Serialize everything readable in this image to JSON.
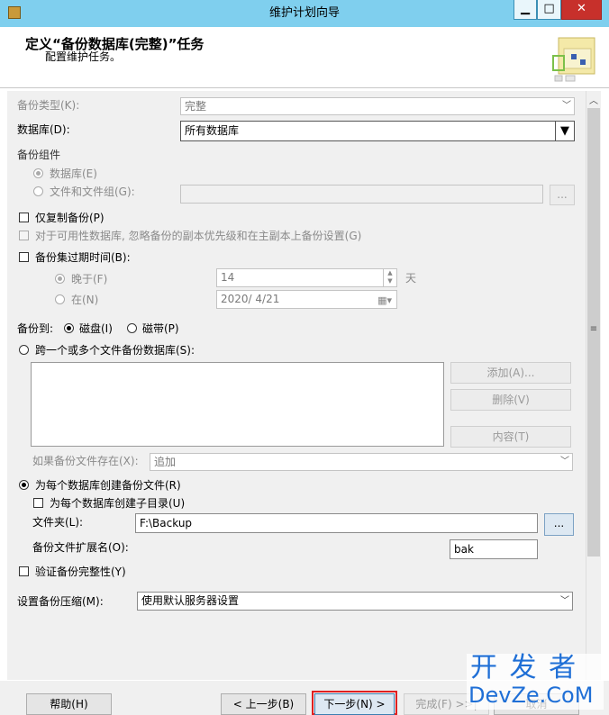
{
  "window": {
    "title": "维护计划向导",
    "minimize": "▁",
    "maximize": "□",
    "close": "✕"
  },
  "header": {
    "title": "定义“备份数据库(完整)”任务",
    "subtitle": "配置维护任务。"
  },
  "form": {
    "backup_type_label": "备份类型(K):",
    "backup_type_value": "完整",
    "database_label": "数据库(D):",
    "database_value": "所有数据库",
    "component_group_label": "备份组件",
    "component_database": "数据库(E)",
    "component_files": "文件和文件组(G):",
    "browse_label": "...",
    "copy_only_label": "仅复制备份(P)",
    "availability_label": "对于可用性数据库, 忽略备份的副本优先级和在主副本上备份设置(G)",
    "expire_label": "备份集过期时间(B):",
    "after_label": "晚于(F)",
    "after_value": "14",
    "days_unit": "天",
    "on_label": "在(N)",
    "on_value": "2020/ 4/21",
    "backup_to_label": "备份到:",
    "disk_label": "磁盘(I)",
    "tape_label": "磁带(P)",
    "span_label": "跨一个或多个文件备份数据库(S):",
    "add_button": "添加(A)...",
    "remove_button": "删除(V)",
    "contents_button": "内容(T)",
    "if_exists_label": "如果备份文件存在(X):",
    "if_exists_value": "追加",
    "per_db_label": "为每个数据库创建备份文件(R)",
    "subdir_label": "为每个数据库创建子目录(U)",
    "folder_label": "文件夹(L):",
    "folder_value": "F:\\Backup",
    "folder_browse": "...",
    "ext_label": "备份文件扩展名(O):",
    "ext_value": "bak",
    "verify_label": "验证备份完整性(Y)",
    "compression_label": "设置备份压缩(M):",
    "compression_value": "使用默认服务器设置"
  },
  "footer": {
    "help": "帮助(H)",
    "back": "< 上一步(B)",
    "next": "下一步(N) >",
    "finish": "完成(F) >>|",
    "cancel": "取消"
  },
  "watermark": {
    "line1": "开 发 者",
    "line2": "DevZe.CoM"
  },
  "colors": {
    "titlebar": "#7fcfee",
    "close": "#c7302b",
    "highlight": "#e02020"
  }
}
